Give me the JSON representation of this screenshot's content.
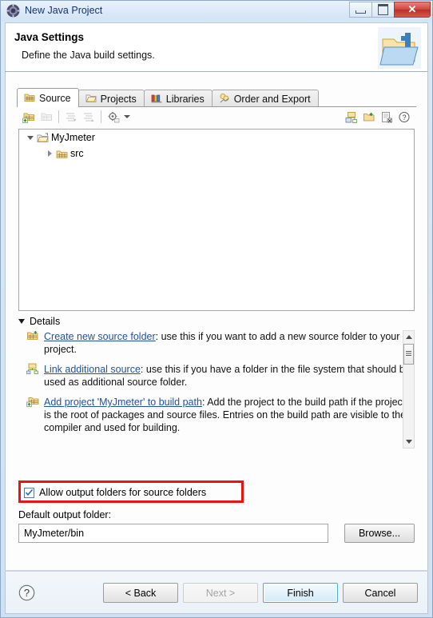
{
  "window": {
    "title": "New Java Project",
    "icon": "eclipse-icon",
    "buttons": {
      "minimize": "minimize-button",
      "maximize": "maximize-button",
      "close": "✕"
    }
  },
  "header": {
    "title": "Java Settings",
    "subtitle": "Define the Java build settings.",
    "icon": "java-settings-folder-icon"
  },
  "tabs": [
    {
      "label": "Source",
      "icon": "source-folder-icon",
      "active": true
    },
    {
      "label": "Projects",
      "icon": "projects-icon",
      "active": false
    },
    {
      "label": "Libraries",
      "icon": "libraries-icon",
      "active": false
    },
    {
      "label": "Order and Export",
      "icon": "order-export-icon",
      "active": false
    }
  ],
  "toolbar": {
    "buttons": [
      "add-folder-icon",
      "remove-folder-icon",
      "expand-all-icon",
      "collapse-all-icon",
      "configure-icon"
    ],
    "dropdown": "chevron-down-icon",
    "right_buttons": [
      "link-source-icon",
      "create-folder-icon",
      "edit-filters-icon",
      "help-icon"
    ]
  },
  "tree": {
    "nodes": [
      {
        "label": "MyJmeter",
        "level": 1,
        "expanded": true,
        "icon": "project-folder-icon"
      },
      {
        "label": "src",
        "level": 2,
        "expanded": false,
        "icon": "source-package-icon"
      }
    ]
  },
  "details": {
    "header": "Details",
    "expanded": true,
    "items": [
      {
        "icon": "create-source-folder-icon",
        "link": "Create new source folder",
        "text": ": use this if you want to add a new source folder to your project."
      },
      {
        "icon": "link-source-icon",
        "link": "Link additional source",
        "text": ": use this if you have a folder in the file system that should be used as additional source folder."
      },
      {
        "icon": "add-project-icon",
        "link": "Add project 'MyJmeter' to build path",
        "text": ": Add the project to the build path if the project is the root of packages and source files. Entries on the build path are visible to the compiler and used for building."
      }
    ]
  },
  "options": {
    "allow_output_folders": {
      "label": "Allow output folders for source folders",
      "checked": true,
      "highlight_color": "#e81313"
    },
    "default_output_folder": {
      "label": "Default output folder:",
      "value": "MyJmeter/bin",
      "placeholder": "",
      "browse_label": "Browse..."
    }
  },
  "footer": {
    "help": "help-button",
    "buttons": [
      {
        "label": "< Back",
        "state": "enabled"
      },
      {
        "label": "Next >",
        "state": "disabled"
      },
      {
        "label": "Finish",
        "state": "default"
      },
      {
        "label": "Cancel",
        "state": "enabled"
      }
    ]
  }
}
